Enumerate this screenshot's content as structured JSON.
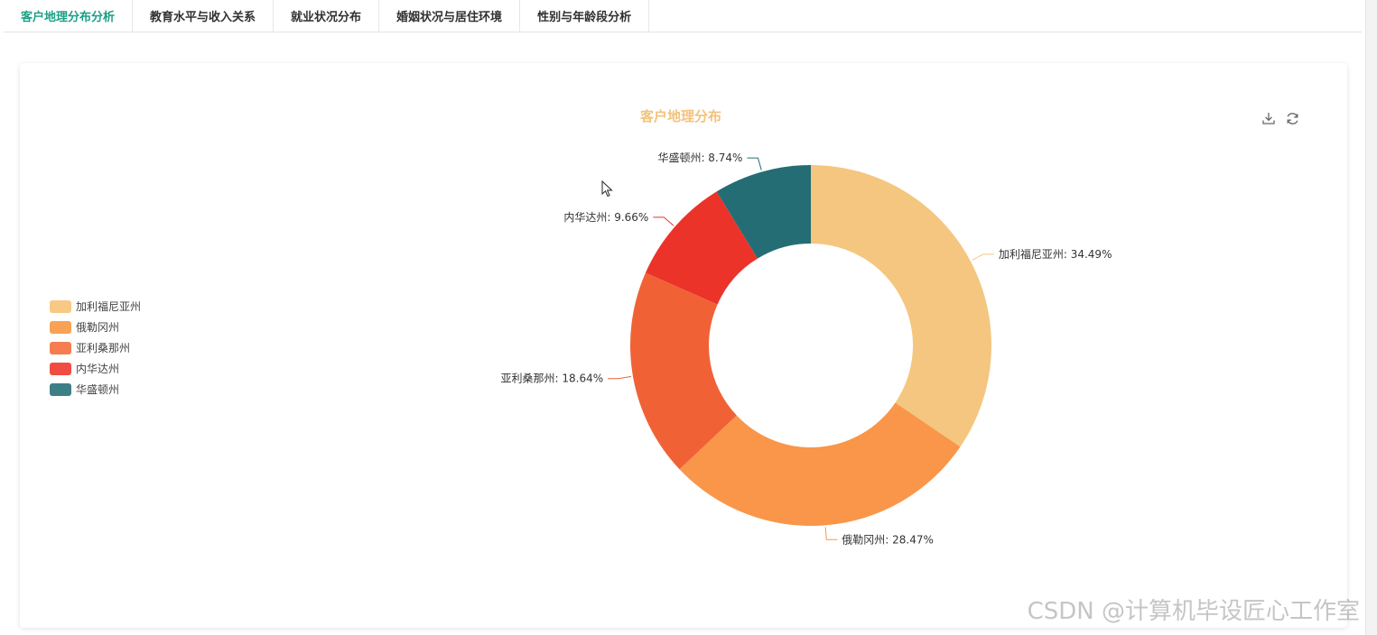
{
  "tabs": [
    {
      "label": "客户地理分布分析",
      "active": true
    },
    {
      "label": "教育水平与收入关系",
      "active": false
    },
    {
      "label": "就业状况分布",
      "active": false
    },
    {
      "label": "婚姻状况与居住环境",
      "active": false
    },
    {
      "label": "性别与年龄段分析",
      "active": false
    }
  ],
  "toolbox": {
    "download_icon": "download-icon",
    "refresh_icon": "refresh-icon"
  },
  "colors": {
    "accent": "#1aa085",
    "title": "#f4c27a"
  },
  "chart_data": {
    "type": "pie",
    "variant": "donut",
    "title": "客户地理分布",
    "legend_position": "left",
    "categories": [
      "加利福尼亚州",
      "俄勒冈州",
      "亚利桑那州",
      "内华达州",
      "华盛顿州"
    ],
    "values": [
      34.49,
      28.47,
      18.64,
      9.66,
      8.74
    ],
    "unit": "%",
    "labels": [
      "加利福尼亚州: 34.49%",
      "俄勒冈州: 28.47%",
      "亚利桑那州: 18.64%",
      "内华达州: 9.66%",
      "华盛顿州: 8.74%"
    ],
    "colors": [
      "#f4c67f",
      "#f99649",
      "#f06236",
      "#ec3329",
      "#246d74"
    ],
    "legend_colors": [
      "#f7c985",
      "#f9a254",
      "#f57d50",
      "#f04c43",
      "#3d7f86"
    ]
  },
  "watermark": "CSDN @计算机毕设匠心工作室"
}
